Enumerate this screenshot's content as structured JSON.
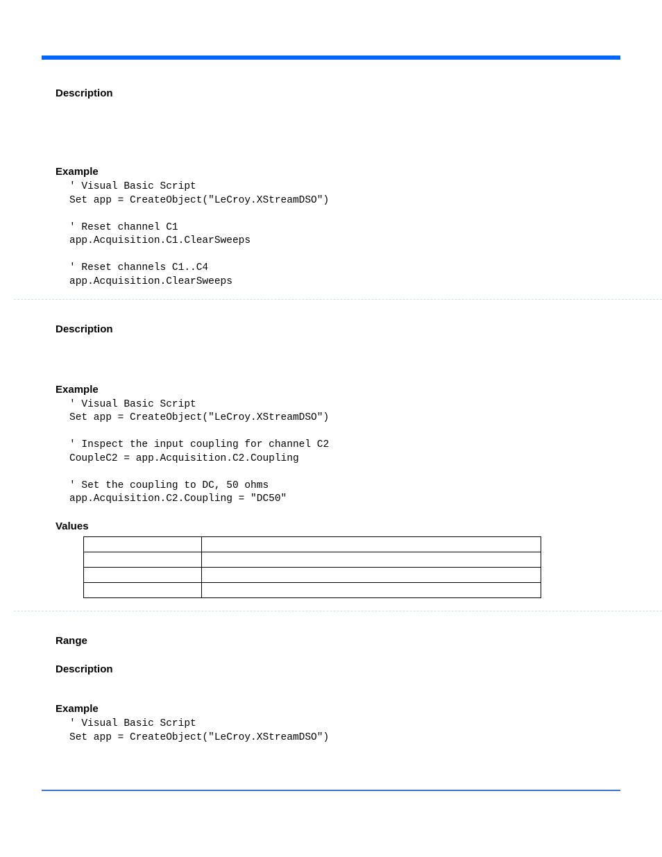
{
  "section1": {
    "desc_label": "Description",
    "example_label": "Example",
    "code": "' Visual Basic Script\nSet app = CreateObject(\"LeCroy.XStreamDSO\")\n\n' Reset channel C1\napp.Acquisition.C1.ClearSweeps\n\n' Reset channels C1..C4\napp.Acquisition.ClearSweeps"
  },
  "section2": {
    "desc_label": "Description",
    "example_label": "Example",
    "code": "' Visual Basic Script\nSet app = CreateObject(\"LeCroy.XStreamDSO\")\n\n' Inspect the input coupling for channel C2\nCoupleC2 = app.Acquisition.C2.Coupling\n\n' Set the coupling to DC, 50 ohms\napp.Acquisition.C2.Coupling = \"DC50\"",
    "values_label": "Values",
    "values_rows": [
      [
        "",
        ""
      ],
      [
        "",
        ""
      ],
      [
        "",
        ""
      ],
      [
        "",
        ""
      ]
    ]
  },
  "section3": {
    "range_label": "Range",
    "desc_label": "Description",
    "example_label": "Example",
    "code": "' Visual Basic Script\nSet app = CreateObject(\"LeCroy.XStreamDSO\")"
  }
}
